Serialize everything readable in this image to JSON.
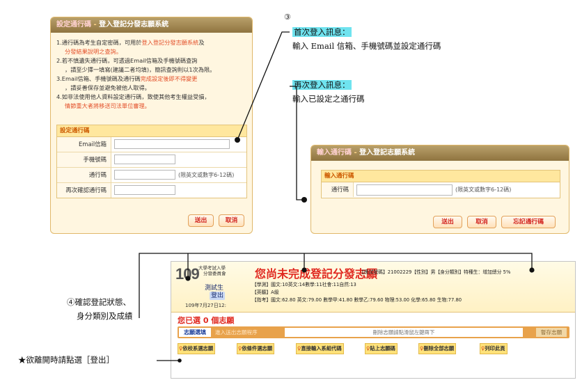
{
  "panel_set_password": {
    "title_prefix": "設定通行碼",
    "title_sep": "-",
    "title_main": "登入登記分發志願系統",
    "notes": {
      "n1a": "1.通行碼為考生自定密碼，可用於",
      "n1b": "登入登記分發志願系統",
      "n1c": "及",
      "n1d": "分發結果說明之查詢。",
      "n2a": "2.若不慎遺失通行碼，可透過Email信箱及手機號碼查詢",
      "n2b": "，請至少擇一填寫(建議二者均填)，簡訊查詢則以1次為限。",
      "n3a": "3.Email信箱、手機號碼及通行碼",
      "n3b": "完成設定後即不得變更",
      "n3c": "，請妥善保存並避免被他人取得。",
      "n4a": "4.如非法使用他人資料設定通行碼，致使其他考生權益受損，",
      "n4b": "情節重大者將移送司法單位審理。"
    },
    "form_title": "設定通行碼",
    "fields": [
      {
        "label": "Email信箱",
        "hint": ""
      },
      {
        "label": "手機號碼",
        "hint": ""
      },
      {
        "label": "通行碼",
        "hint": "(限英文或數字6-12碼)"
      },
      {
        "label": "再次確認通行碼",
        "hint": ""
      }
    ],
    "submit": "送出",
    "cancel": "取消"
  },
  "panel_login": {
    "title_prefix": "輸入通行碼",
    "title_sep": "-",
    "title_main": "登入登記志願系統",
    "form_title": "輸入通行碼",
    "field_label": "通行碼",
    "field_hint": "(限英文或數字6-12碼)",
    "submit": "送出",
    "cancel": "取消",
    "forgot": "忘記通行碼"
  },
  "annotations": {
    "step3": "③",
    "first_login_title": "首次登入訊息：",
    "first_login_desc": "輸入 Email 信箱、手機號碼並設定通行碼",
    "again_login_title": "再次登入訊息：",
    "again_login_desc": "輸入已設定之通行碼",
    "step4_line1": "④確認登記狀態、",
    "step4_line2": "身分類別及成績",
    "logout_note": "★欲離開時請點選［登出］"
  },
  "status_panel": {
    "logo_number": "109",
    "logo_org_1": "大學考試入學",
    "logo_org_2": "分發委員會",
    "user_name": "測試生",
    "logout": "登出",
    "datetime": "109年7月27日12:",
    "headline": "您尚未完成登記分發志願",
    "info1": "【應試號碼】21002229【性別】男【身分類別】特種生：增加總分 5%",
    "score1": "【學測】國文:10英文:14數學:11社會:11自然:13",
    "exam2": "【英聽】A級",
    "score2": "【指考】國文:62.80 英文:79.00 數學甲:41.80 數學乙:79.60 物理:53.00 化學:65.80 生物:77.80",
    "selected": "您已選 0 個志願",
    "tab_active": "志願選填",
    "tab_dim": "進入送出志願程序",
    "drag_hint": "刪除志願請點滑鼠左鍵兩下",
    "save": "暫存志願",
    "actions": [
      "依校系選志願",
      "依條件選志願",
      "直接輸入系組代碼",
      "貼上志願碼",
      "刪除全部志願",
      "列印此頁"
    ]
  }
}
